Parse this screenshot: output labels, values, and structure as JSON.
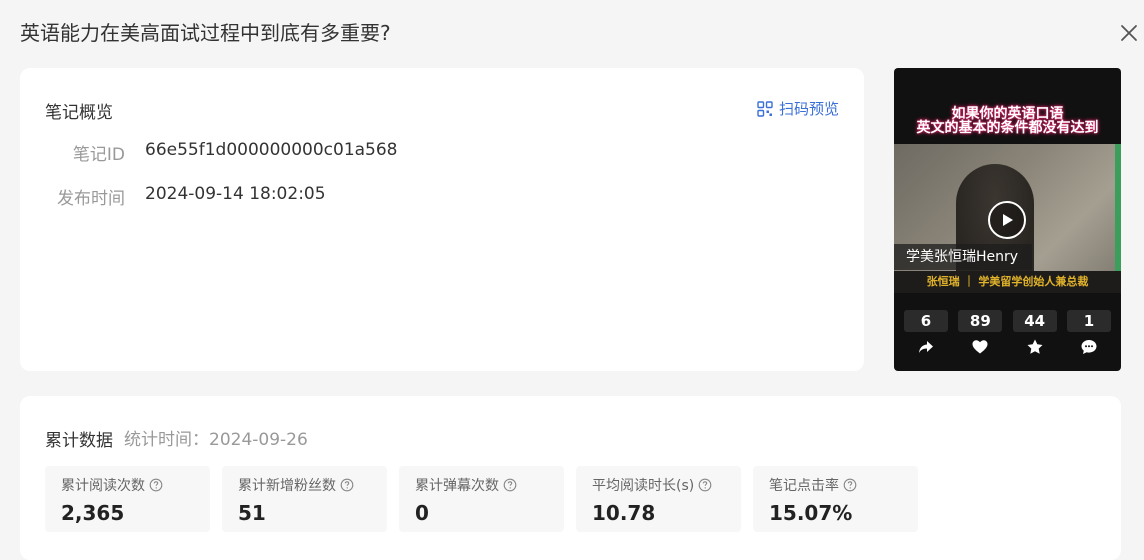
{
  "page": {
    "title": "英语能力在美高面试过程中到底有多重要?"
  },
  "overview": {
    "title": "笔记概览",
    "scan_preview_label": "扫码预览",
    "note_id_label": "笔记ID",
    "note_id_value": "66e55f1d000000000c01a568",
    "publish_time_label": "发布时间",
    "publish_time_value": "2024-09-14 18:02:05"
  },
  "preview": {
    "caption_line1": "如果你的英语口语",
    "caption_line2": "英文的基本的条件都没有达到",
    "name_tag": "学美张恒瑞Henry",
    "subtitle_bar": "张恒瑞 ｜ 学美留学创始人兼总裁",
    "stats": [
      {
        "value": "6",
        "icon": "share-icon"
      },
      {
        "value": "89",
        "icon": "heart-icon"
      },
      {
        "value": "44",
        "icon": "star-icon"
      },
      {
        "value": "1",
        "icon": "comment-icon"
      }
    ]
  },
  "cumulative": {
    "title": "累计数据",
    "stat_time": "统计时间：2024-09-26",
    "metrics": [
      {
        "label": "累计阅读次数",
        "value": "2,365"
      },
      {
        "label": "累计新增粉丝数",
        "value": "51"
      },
      {
        "label": "累计弹幕次数",
        "value": "0"
      },
      {
        "label": "平均阅读时长(s)",
        "value": "10.78"
      },
      {
        "label": "笔记点击率",
        "value": "15.07%"
      }
    ]
  },
  "colors": {
    "accent": "#3a6fd8",
    "background": "#f5f5f5",
    "card": "#ffffff"
  }
}
